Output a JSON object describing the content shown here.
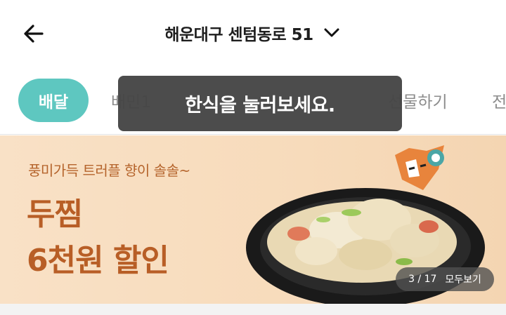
{
  "header": {
    "address": "해운대구 센텀동로 51"
  },
  "tabs": [
    {
      "label": "배달",
      "active": true
    },
    {
      "label": "배민1",
      "active": false
    },
    {
      "label": "선물하기",
      "active": false
    },
    {
      "label": "전",
      "active": false
    }
  ],
  "toast": {
    "message": "한식을 눌러보세요."
  },
  "banner": {
    "subtitle": "풍미가득 트러플 향이 솔솔~",
    "title_line1": "두찜",
    "title_line2": "6천원 할인",
    "counter": "3 / 17",
    "view_all": "모두보기"
  },
  "colors": {
    "accent": "#5ec7c0",
    "banner_bg": "#f9e1c6",
    "banner_text": "#b85e26"
  }
}
